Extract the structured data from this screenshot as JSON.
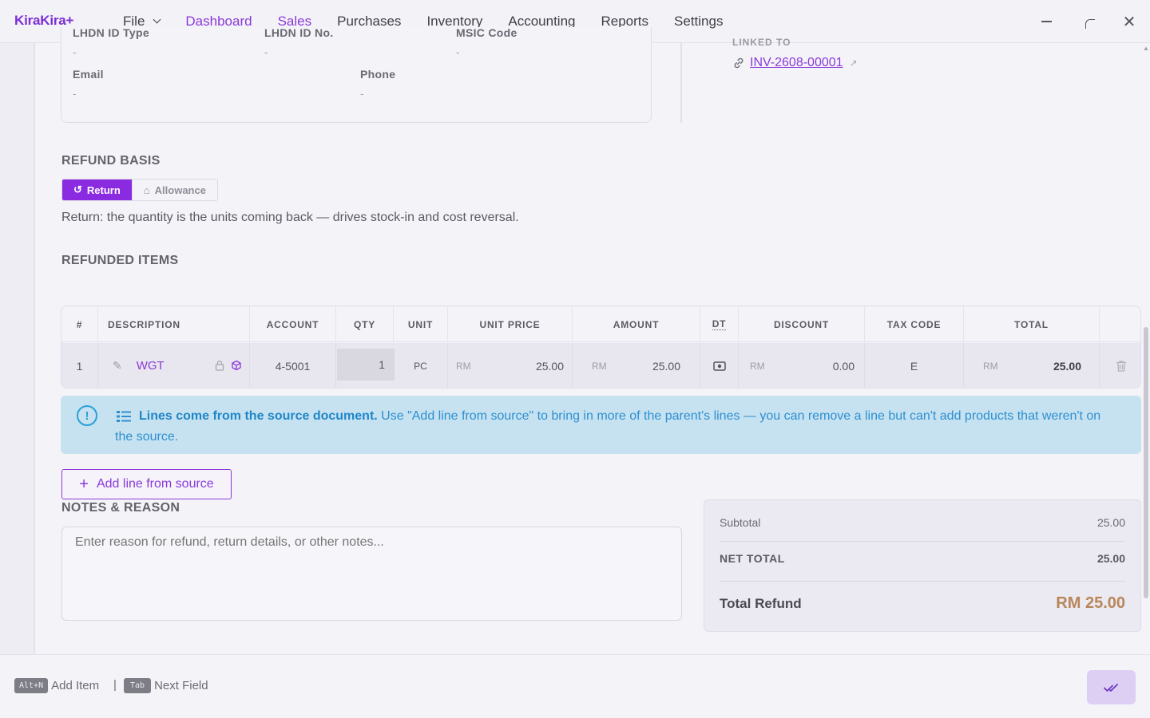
{
  "app": {
    "logo": "KiraKira+"
  },
  "menu": {
    "file": "File",
    "items": [
      "Dashboard",
      "Sales",
      "Purchases",
      "Inventory",
      "Accounting",
      "Reports",
      "Settings"
    ],
    "active": "Sales"
  },
  "customer": {
    "lhdn_id_type_label": "LHDN ID Type",
    "lhdn_id_type_value": "-",
    "lhdn_id_no_label": "LHDN ID No.",
    "lhdn_id_no_value": "-",
    "msic_label": "MSIC Code",
    "msic_value": "-",
    "email_label": "Email",
    "email_value": "-",
    "phone_label": "Phone",
    "phone_value": "-"
  },
  "linked": {
    "label": "LINKED TO",
    "invoice": "INV-2608-00001"
  },
  "refund_basis": {
    "title": "REFUND BASIS",
    "options": [
      "Return",
      "Allowance"
    ],
    "selected": "Return",
    "hint": "Return: the quantity is the units coming back — drives stock-in and cost reversal."
  },
  "items": {
    "title": "REFUNDED ITEMS",
    "columns": [
      "#",
      "DESCRIPTION",
      "ACCOUNT",
      "QTY",
      "UNIT",
      "UNIT PRICE",
      "AMOUNT",
      "DT",
      "DISCOUNT",
      "TAX CODE",
      "TOTAL"
    ],
    "currency": "RM",
    "rows": [
      {
        "no": "1",
        "description": "WGT",
        "account": "4-5001",
        "qty": "1",
        "unit": "PC",
        "unit_price": "25.00",
        "amount": "25.00",
        "discount": "0.00",
        "tax_code": "E",
        "total": "25.00"
      }
    ]
  },
  "banner": {
    "bold": "Lines come from the source document.",
    "text": " Use \"Add line from source\" to bring in more of the parent's lines — you can remove a line but can't add products that weren't on the source."
  },
  "add_line_label": "Add line from source",
  "notes": {
    "title": "NOTES & REASON",
    "placeholder": "Enter reason for refund, return details, or other notes..."
  },
  "totals": {
    "subtotal_label": "Subtotal",
    "subtotal": "25.00",
    "net_total_label": "NET TOTAL",
    "net_total": "25.00",
    "total_refund_label": "Total Refund",
    "total_refund": "RM 25.00"
  },
  "shortcuts": {
    "add_key": "Alt+N",
    "add_label": "Add Item",
    "sep": "|",
    "next_key": "Tab",
    "next_label": "Next Field"
  },
  "colors": {
    "accent": "#8a2be2",
    "refund_total": "#b8865a",
    "banner_bg": "#c6e2f1"
  }
}
